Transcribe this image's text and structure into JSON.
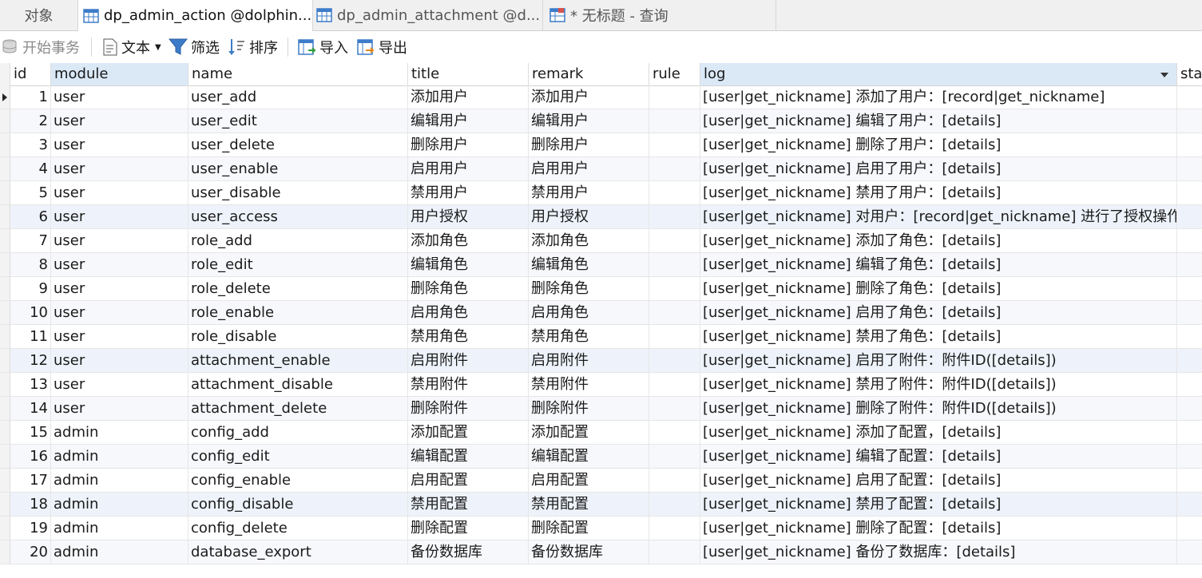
{
  "tabs": [
    {
      "label": "对象",
      "icon": "none",
      "active": false
    },
    {
      "label": "dp_admin_action @dolphin...",
      "icon": "table-icon",
      "active": true
    },
    {
      "label": "dp_admin_attachment @d...",
      "icon": "table-icon",
      "active": false
    },
    {
      "label": "* 无标题 - 查询",
      "icon": "query-icon",
      "active": false
    }
  ],
  "toolbar": {
    "begin_transaction": "开始事务",
    "text": "文本",
    "filter": "筛选",
    "sort": "排序",
    "import": "导入",
    "export": "导出"
  },
  "columns": [
    "id",
    "module",
    "name",
    "title",
    "remark",
    "rule",
    "log",
    "stat"
  ],
  "rows": [
    {
      "id": "1",
      "module": "user",
      "name": "user_add",
      "title": "添加用户",
      "remark": "添加用户",
      "rule": "",
      "log": "[user|get_nickname] 添加了用户：[record|get_nickname]"
    },
    {
      "id": "2",
      "module": "user",
      "name": "user_edit",
      "title": "编辑用户",
      "remark": "编辑用户",
      "rule": "",
      "log": "[user|get_nickname] 编辑了用户：[details]"
    },
    {
      "id": "3",
      "module": "user",
      "name": "user_delete",
      "title": "删除用户",
      "remark": "删除用户",
      "rule": "",
      "log": "[user|get_nickname] 删除了用户：[details]"
    },
    {
      "id": "4",
      "module": "user",
      "name": "user_enable",
      "title": "启用用户",
      "remark": "启用用户",
      "rule": "",
      "log": "[user|get_nickname] 启用了用户：[details]"
    },
    {
      "id": "5",
      "module": "user",
      "name": "user_disable",
      "title": "禁用用户",
      "remark": "禁用用户",
      "rule": "",
      "log": "[user|get_nickname] 禁用了用户：[details]"
    },
    {
      "id": "6",
      "module": "user",
      "name": "user_access",
      "title": "用户授权",
      "remark": "用户授权",
      "rule": "",
      "log": "[user|get_nickname] 对用户：[record|get_nickname] 进行了授权操作。"
    },
    {
      "id": "7",
      "module": "user",
      "name": "role_add",
      "title": "添加角色",
      "remark": "添加角色",
      "rule": "",
      "log": "[user|get_nickname] 添加了角色：[details]"
    },
    {
      "id": "8",
      "module": "user",
      "name": "role_edit",
      "title": "编辑角色",
      "remark": "编辑角色",
      "rule": "",
      "log": "[user|get_nickname] 编辑了角色：[details]"
    },
    {
      "id": "9",
      "module": "user",
      "name": "role_delete",
      "title": "删除角色",
      "remark": "删除角色",
      "rule": "",
      "log": "[user|get_nickname] 删除了角色：[details]"
    },
    {
      "id": "10",
      "module": "user",
      "name": "role_enable",
      "title": "启用角色",
      "remark": "启用角色",
      "rule": "",
      "log": "[user|get_nickname] 启用了角色：[details]"
    },
    {
      "id": "11",
      "module": "user",
      "name": "role_disable",
      "title": "禁用角色",
      "remark": "禁用角色",
      "rule": "",
      "log": "[user|get_nickname] 禁用了角色：[details]"
    },
    {
      "id": "12",
      "module": "user",
      "name": "attachment_enable",
      "title": "启用附件",
      "remark": "启用附件",
      "rule": "",
      "log": "[user|get_nickname] 启用了附件：附件ID([details])"
    },
    {
      "id": "13",
      "module": "user",
      "name": "attachment_disable",
      "title": "禁用附件",
      "remark": "禁用附件",
      "rule": "",
      "log": "[user|get_nickname] 禁用了附件：附件ID([details])"
    },
    {
      "id": "14",
      "module": "user",
      "name": "attachment_delete",
      "title": "删除附件",
      "remark": "删除附件",
      "rule": "",
      "log": "[user|get_nickname] 删除了附件：附件ID([details])"
    },
    {
      "id": "15",
      "module": "admin",
      "name": "config_add",
      "title": "添加配置",
      "remark": "添加配置",
      "rule": "",
      "log": "[user|get_nickname] 添加了配置，[details]"
    },
    {
      "id": "16",
      "module": "admin",
      "name": "config_edit",
      "title": "编辑配置",
      "remark": "编辑配置",
      "rule": "",
      "log": "[user|get_nickname] 编辑了配置：[details]"
    },
    {
      "id": "17",
      "module": "admin",
      "name": "config_enable",
      "title": "启用配置",
      "remark": "启用配置",
      "rule": "",
      "log": "[user|get_nickname] 启用了配置：[details]"
    },
    {
      "id": "18",
      "module": "admin",
      "name": "config_disable",
      "title": "禁用配置",
      "remark": "禁用配置",
      "rule": "",
      "log": "[user|get_nickname] 禁用了配置：[details]"
    },
    {
      "id": "19",
      "module": "admin",
      "name": "config_delete",
      "title": "删除配置",
      "remark": "删除配置",
      "rule": "",
      "log": "[user|get_nickname] 删除了配置：[details]"
    },
    {
      "id": "20",
      "module": "admin",
      "name": "database_export",
      "title": "备份数据库",
      "remark": "备份数据库",
      "rule": "",
      "log": "[user|get_nickname] 备份了数据库：[details]"
    }
  ],
  "colors": {
    "selected_header": "#dbe9f7",
    "row_alt": "#f6f8fb",
    "icon_blue": "#3d7cc9"
  }
}
